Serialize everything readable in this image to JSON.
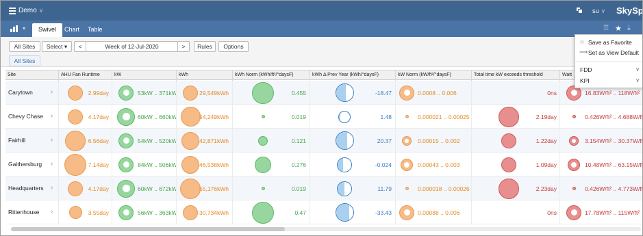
{
  "header": {
    "project": "Demo",
    "user": "su",
    "brand": "SkySpark"
  },
  "appbar": {
    "tabs": [
      {
        "label": "Swivel"
      },
      {
        "label": "Chart"
      },
      {
        "label": "Table"
      }
    ]
  },
  "toolbar": {
    "all_sites": "All Sites",
    "select": "Select",
    "date_range": "Week of 12-Jul-2020",
    "rules": "Rules",
    "options": "Options",
    "chip": "All Sites"
  },
  "menu": {
    "items": [
      {
        "label": "Save as Favorite",
        "icon": "star-outline-icon"
      },
      {
        "label": "Set as View Default",
        "icon": "arrow-right-icon"
      }
    ],
    "groups": [
      {
        "label": "FDD"
      },
      {
        "label": "KPI"
      }
    ]
  },
  "table": {
    "columns": [
      "Site",
      "AHU Fan Runtime",
      "kW",
      "kWh",
      "kWh Norm (kWh/ft²/°daysF)",
      "kWh Δ Prev Year (kWh/°daysF)",
      "kW Norm (kW/ft²/°daysF)",
      "Total time kW exceeds threshold",
      "Watt"
    ],
    "rows": [
      {
        "site": "Carytown",
        "runtime": "2.99day",
        "kw": "53kW .. 371kW",
        "kwh": "29,549kWh",
        "kwh_norm": "0.455",
        "kwh_delta": "-18.47",
        "kw_norm": "0.0008 .. 0.006",
        "threshold": "0ns",
        "watt": "16.83W/ft² .. 118W/ft²"
      },
      {
        "site": "Chevy Chase",
        "runtime": "4.17day",
        "kw": "60kW .. 660kW",
        "kwh": "54,249kWh",
        "kwh_norm": "0.019",
        "kwh_delta": "1.48",
        "kw_norm": "0.000021 .. 0.00025",
        "threshold": "2.19day",
        "watt": "0.426W/ft² .. 4.688W/ft²"
      },
      {
        "site": "Fairhill",
        "runtime": "6.56day",
        "kw": "54kW .. 520kW",
        "kwh": "42,871kWh",
        "kwh_norm": "0.121",
        "kwh_delta": "20.37",
        "kw_norm": "0.00015 .. 0.002",
        "threshold": "1.22day",
        "watt": "3.154W/ft² .. 30.37W/ft²"
      },
      {
        "site": "Gaithersburg",
        "runtime": "7.14day",
        "kw": "84kW .. 506kW",
        "kwh": "46,538kWh",
        "kwh_norm": "0.276",
        "kwh_delta": "-0.024",
        "kw_norm": "0.00043 .. 0.003",
        "threshold": "1.09day",
        "watt": "10.48W/ft² .. 63.15W/ft²"
      },
      {
        "site": "Headquarters",
        "runtime": "4.17day",
        "kw": "60kW .. 672kW",
        "kwh": "55,176kWh",
        "kwh_norm": "0.019",
        "kwh_delta": "11.79",
        "kw_norm": "0.000018 .. 0.00026",
        "threshold": "2.23day",
        "watt": "0.426W/ft² .. 4.773W/ft²"
      },
      {
        "site": "Rittenhouse",
        "runtime": "3.55day",
        "kw": "56kW .. 363kW",
        "kwh": "30,734kWh",
        "kwh_norm": "0.47",
        "kwh_delta": "-33.43",
        "kw_norm": "0.00088 .. 0.006",
        "threshold": "0ns",
        "watt": "17.78W/ft² .. 115W/ft²"
      }
    ]
  },
  "colors": {
    "header": "#3e6590",
    "appbar": "#4a74a6",
    "orange": "#e58a27",
    "green": "#4aa44f",
    "blue": "#3c7dc4",
    "red": "#c73c3c"
  }
}
